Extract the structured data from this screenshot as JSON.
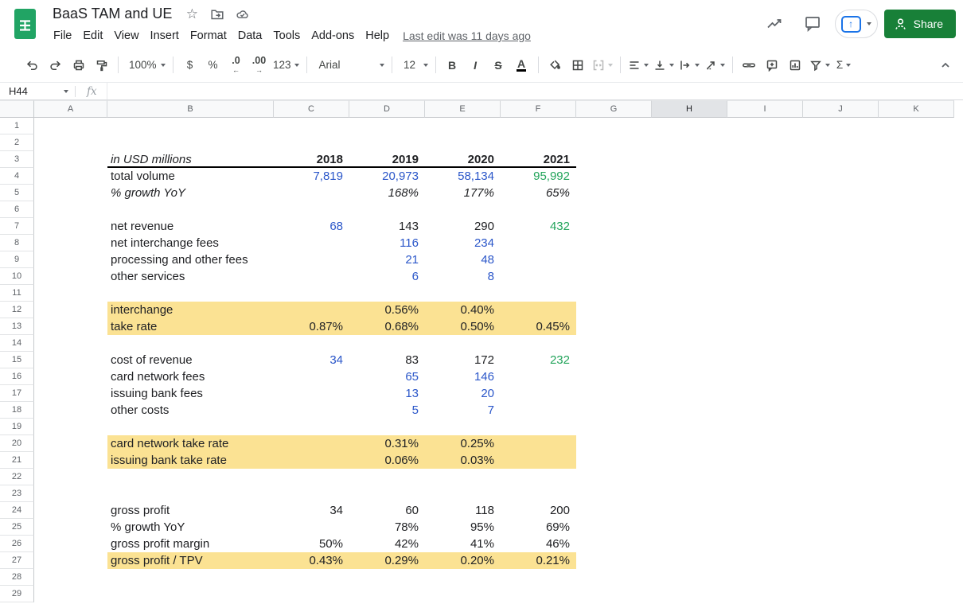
{
  "app": {
    "title": "BaaS TAM and UE",
    "menu": [
      "File",
      "Edit",
      "View",
      "Insert",
      "Format",
      "Data",
      "Tools",
      "Add-ons",
      "Help"
    ],
    "last_edit": "Last edit was 11 days ago",
    "doc_icons": [
      "star-icon",
      "move-folder-icon",
      "cloud-saved-icon"
    ],
    "top_right_icons": [
      "insights-icon",
      "comment-history-icon"
    ],
    "share_label": "Share"
  },
  "toolbar": {
    "items": [
      {
        "name": "undo",
        "icon": "undo"
      },
      {
        "name": "redo",
        "icon": "redo"
      },
      {
        "name": "print",
        "icon": "print"
      },
      {
        "name": "paint-format",
        "icon": "paint"
      },
      {
        "sep": true
      },
      {
        "name": "zoom",
        "text": "100%",
        "caret": true,
        "cls": "zoom-val"
      },
      {
        "sep": true
      },
      {
        "name": "format-currency",
        "text": "$"
      },
      {
        "name": "format-percent",
        "text": "%"
      },
      {
        "name": "decrease-decimal",
        "text": ".0",
        "sub": "←"
      },
      {
        "name": "increase-decimal",
        "text": ".00",
        "sub": "→"
      },
      {
        "name": "number-format",
        "text": "123",
        "caret": true
      },
      {
        "sep": true
      },
      {
        "name": "font-family",
        "text": "Arial",
        "caret": true,
        "cls": "font-name"
      },
      {
        "sep": true
      },
      {
        "name": "font-size",
        "text": "12",
        "caret": true,
        "cls": "size-val"
      },
      {
        "sep": true
      },
      {
        "name": "bold",
        "text": "B",
        "style": "bold-g"
      },
      {
        "name": "italic",
        "text": "I",
        "style": "italic-g"
      },
      {
        "name": "strikethrough",
        "text": "S",
        "style": "strike-g"
      },
      {
        "name": "text-color",
        "text": "A",
        "style": "underbar-g"
      },
      {
        "sep": true
      },
      {
        "name": "fill-color",
        "icon": "fill"
      },
      {
        "name": "borders",
        "icon": "borders"
      },
      {
        "name": "merge-cells",
        "icon": "merge",
        "caret": true,
        "disabled": true
      },
      {
        "sep": true
      },
      {
        "name": "horizontal-align",
        "icon": "alignleft",
        "caret": true
      },
      {
        "name": "vertical-align",
        "icon": "valign",
        "caret": true
      },
      {
        "name": "text-wrap",
        "icon": "wrap",
        "caret": true
      },
      {
        "name": "text-rotation",
        "icon": "rotate",
        "caret": true
      },
      {
        "sep": true
      },
      {
        "name": "insert-link",
        "icon": "link"
      },
      {
        "name": "insert-comment",
        "icon": "commentadd"
      },
      {
        "name": "insert-chart",
        "icon": "chart"
      },
      {
        "name": "filter",
        "icon": "filter",
        "caret": true
      },
      {
        "name": "functions",
        "text": "Σ",
        "caret": true
      }
    ]
  },
  "formula_bar": {
    "name_box": "H44",
    "fx_label": "fx",
    "value": ""
  },
  "colors": {
    "value_blue": "#2a56c9",
    "value_green": "#23a45b",
    "highlight_yellow": "#fbe293",
    "share_green": "#188038",
    "present_blue": "#1a73e8"
  },
  "sheet": {
    "columns": [
      "A",
      "B",
      "C",
      "D",
      "E",
      "F",
      "G",
      "H",
      "I",
      "J",
      "K"
    ],
    "selected_column": "H",
    "row_count": 29,
    "rows": [
      {
        "r": 3,
        "rule_bottom": "B:F",
        "cells": [
          {
            "c": "B",
            "t": "in USD millions",
            "cls": "label italic"
          },
          {
            "c": "C",
            "t": "2018",
            "cls": "num bold"
          },
          {
            "c": "D",
            "t": "2019",
            "cls": "num bold"
          },
          {
            "c": "E",
            "t": "2020",
            "cls": "num bold"
          },
          {
            "c": "F",
            "t": "2021",
            "cls": "num bold"
          }
        ]
      },
      {
        "r": 4,
        "cells": [
          {
            "c": "B",
            "t": "total volume",
            "cls": "label"
          },
          {
            "c": "C",
            "t": "7,819",
            "cls": "num blue"
          },
          {
            "c": "D",
            "t": "20,973",
            "cls": "num blue"
          },
          {
            "c": "E",
            "t": "58,134",
            "cls": "num blue"
          },
          {
            "c": "F",
            "t": "95,992",
            "cls": "num green"
          }
        ]
      },
      {
        "r": 5,
        "cells": [
          {
            "c": "B",
            "t": "% growth YoY",
            "cls": "label italic"
          },
          {
            "c": "D",
            "t": "168%",
            "cls": "num italic"
          },
          {
            "c": "E",
            "t": "177%",
            "cls": "num italic"
          },
          {
            "c": "F",
            "t": "65%",
            "cls": "num italic"
          }
        ]
      },
      {
        "r": 7,
        "cells": [
          {
            "c": "B",
            "t": "net revenue",
            "cls": "label"
          },
          {
            "c": "C",
            "t": "68",
            "cls": "num blue"
          },
          {
            "c": "D",
            "t": "143",
            "cls": "num"
          },
          {
            "c": "E",
            "t": "290",
            "cls": "num"
          },
          {
            "c": "F",
            "t": "432",
            "cls": "num green"
          }
        ]
      },
      {
        "r": 8,
        "cells": [
          {
            "c": "B",
            "t": "net interchange fees",
            "cls": "label"
          },
          {
            "c": "D",
            "t": "116",
            "cls": "num blue"
          },
          {
            "c": "E",
            "t": "234",
            "cls": "num blue"
          }
        ]
      },
      {
        "r": 9,
        "cells": [
          {
            "c": "B",
            "t": "processing and other fees",
            "cls": "label"
          },
          {
            "c": "D",
            "t": "21",
            "cls": "num blue"
          },
          {
            "c": "E",
            "t": "48",
            "cls": "num blue"
          }
        ]
      },
      {
        "r": 10,
        "cells": [
          {
            "c": "B",
            "t": "other services",
            "cls": "label"
          },
          {
            "c": "D",
            "t": "6",
            "cls": "num blue"
          },
          {
            "c": "E",
            "t": "8",
            "cls": "num blue"
          }
        ]
      },
      {
        "r": 12,
        "highlight": "B:F",
        "cells": [
          {
            "c": "B",
            "t": "interchange",
            "cls": "label"
          },
          {
            "c": "D",
            "t": "0.56%",
            "cls": "num"
          },
          {
            "c": "E",
            "t": "0.40%",
            "cls": "num"
          }
        ]
      },
      {
        "r": 13,
        "highlight": "B:F",
        "cells": [
          {
            "c": "B",
            "t": "take rate",
            "cls": "label"
          },
          {
            "c": "C",
            "t": "0.87%",
            "cls": "num"
          },
          {
            "c": "D",
            "t": "0.68%",
            "cls": "num"
          },
          {
            "c": "E",
            "t": "0.50%",
            "cls": "num"
          },
          {
            "c": "F",
            "t": "0.45%",
            "cls": "num"
          }
        ]
      },
      {
        "r": 15,
        "cells": [
          {
            "c": "B",
            "t": "cost of revenue",
            "cls": "label"
          },
          {
            "c": "C",
            "t": "34",
            "cls": "num blue"
          },
          {
            "c": "D",
            "t": "83",
            "cls": "num"
          },
          {
            "c": "E",
            "t": "172",
            "cls": "num"
          },
          {
            "c": "F",
            "t": "232",
            "cls": "num green"
          }
        ]
      },
      {
        "r": 16,
        "cells": [
          {
            "c": "B",
            "t": "card network fees",
            "cls": "label"
          },
          {
            "c": "D",
            "t": "65",
            "cls": "num blue"
          },
          {
            "c": "E",
            "t": "146",
            "cls": "num blue"
          }
        ]
      },
      {
        "r": 17,
        "cells": [
          {
            "c": "B",
            "t": "issuing bank fees",
            "cls": "label"
          },
          {
            "c": "D",
            "t": "13",
            "cls": "num blue"
          },
          {
            "c": "E",
            "t": "20",
            "cls": "num blue"
          }
        ]
      },
      {
        "r": 18,
        "cells": [
          {
            "c": "B",
            "t": "other costs",
            "cls": "label"
          },
          {
            "c": "D",
            "t": "5",
            "cls": "num blue"
          },
          {
            "c": "E",
            "t": "7",
            "cls": "num blue"
          }
        ]
      },
      {
        "r": 20,
        "highlight": "B:F",
        "cells": [
          {
            "c": "B",
            "t": "card network take rate",
            "cls": "label"
          },
          {
            "c": "D",
            "t": "0.31%",
            "cls": "num"
          },
          {
            "c": "E",
            "t": "0.25%",
            "cls": "num"
          }
        ]
      },
      {
        "r": 21,
        "highlight": "B:F",
        "cells": [
          {
            "c": "B",
            "t": "issuing bank take rate",
            "cls": "label"
          },
          {
            "c": "D",
            "t": "0.06%",
            "cls": "num"
          },
          {
            "c": "E",
            "t": "0.03%",
            "cls": "num"
          }
        ]
      },
      {
        "r": 24,
        "cells": [
          {
            "c": "B",
            "t": "gross profit",
            "cls": "label"
          },
          {
            "c": "C",
            "t": "34",
            "cls": "num"
          },
          {
            "c": "D",
            "t": "60",
            "cls": "num"
          },
          {
            "c": "E",
            "t": "118",
            "cls": "num"
          },
          {
            "c": "F",
            "t": "200",
            "cls": "num"
          }
        ]
      },
      {
        "r": 25,
        "cells": [
          {
            "c": "B",
            "t": "% growth YoY",
            "cls": "label"
          },
          {
            "c": "D",
            "t": "78%",
            "cls": "num"
          },
          {
            "c": "E",
            "t": "95%",
            "cls": "num"
          },
          {
            "c": "F",
            "t": "69%",
            "cls": "num"
          }
        ]
      },
      {
        "r": 26,
        "cells": [
          {
            "c": "B",
            "t": "gross profit margin",
            "cls": "label"
          },
          {
            "c": "C",
            "t": "50%",
            "cls": "num"
          },
          {
            "c": "D",
            "t": "42%",
            "cls": "num"
          },
          {
            "c": "E",
            "t": "41%",
            "cls": "num"
          },
          {
            "c": "F",
            "t": "46%",
            "cls": "num"
          }
        ]
      },
      {
        "r": 27,
        "highlight": "B:F",
        "cells": [
          {
            "c": "B",
            "t": "gross profit / TPV",
            "cls": "label"
          },
          {
            "c": "C",
            "t": "0.43%",
            "cls": "num"
          },
          {
            "c": "D",
            "t": "0.29%",
            "cls": "num"
          },
          {
            "c": "E",
            "t": "0.20%",
            "cls": "num"
          },
          {
            "c": "F",
            "t": "0.21%",
            "cls": "num"
          }
        ]
      }
    ]
  }
}
